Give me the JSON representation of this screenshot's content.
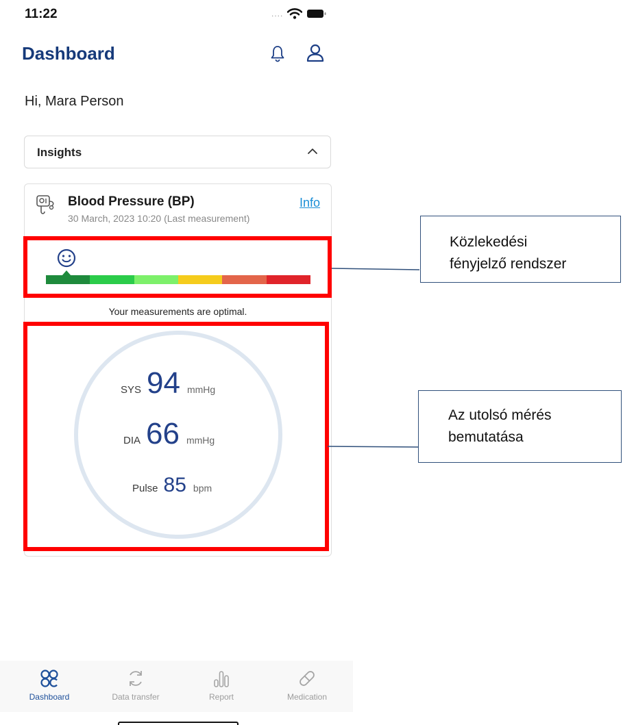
{
  "status_bar": {
    "time": "11:22",
    "signal": "....",
    "icons": [
      "wifi-icon",
      "battery-icon"
    ]
  },
  "header": {
    "title": "Dashboard",
    "icons": [
      "bell-icon",
      "user-icon"
    ]
  },
  "greeting": "Hi, Mara Person",
  "insights": {
    "label": "Insights",
    "expanded": true
  },
  "bp_card": {
    "title": "Blood Pressure (BP)",
    "subtitle": "30 March, 2023 10:20 (Last measurement)",
    "info_link": "Info",
    "traffic_light": {
      "mood": "smiley-icon",
      "selected_segment": 1,
      "segments": [
        "#1e8a3c",
        "#2bcc4a",
        "#7df06a",
        "#f5cc1c",
        "#e3654a",
        "#e0242a"
      ]
    },
    "status_text": "Your measurements are optimal.",
    "measurements": {
      "sys": {
        "label": "SYS",
        "value": "94",
        "unit": "mmHg"
      },
      "dia": {
        "label": "DIA",
        "value": "66",
        "unit": "mmHg"
      },
      "pulse": {
        "label": "Pulse",
        "value": "85",
        "unit": "bpm"
      }
    }
  },
  "annotations": {
    "traffic_callout": {
      "line1": "Közlekedési",
      "line2": "fényjelző rendszer",
      "border_color": "#ff0000"
    },
    "measurement_callout": {
      "line1": "Az utolsó mérés",
      "line2": "bemutatása",
      "border_color": "#ff0000"
    }
  },
  "bottom_nav": {
    "active": "dashboard",
    "items": [
      {
        "label": "Dashboard",
        "icon": "dashboard-grid-icon"
      },
      {
        "label": "Data transfer",
        "icon": "sync-icon"
      },
      {
        "label": "Report",
        "icon": "report-bars-icon"
      },
      {
        "label": "Medication",
        "icon": "pill-icon"
      }
    ]
  }
}
